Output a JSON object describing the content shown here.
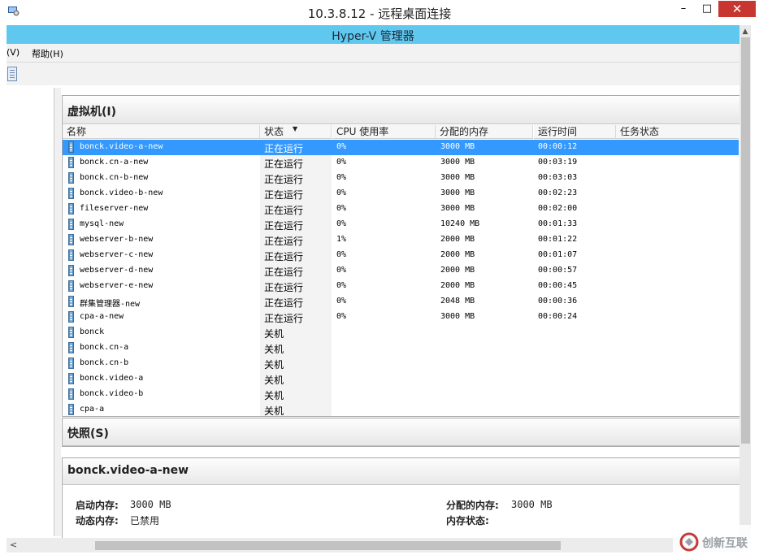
{
  "window": {
    "title": "10.3.8.12 - 远程桌面连接",
    "minimize_glyph": "–",
    "maximize_glyph": "□",
    "close_glyph": "✕"
  },
  "app": {
    "title": "Hyper-V 管理器"
  },
  "menu": {
    "view": "(V)",
    "help": "帮助(H)"
  },
  "vm_section": {
    "title": "虚拟机(I)",
    "columns": [
      "名称",
      "状态",
      "CPU 使用率",
      "分配的内存",
      "运行时间",
      "任务状态"
    ],
    "sort_indicator": "▼",
    "rows": [
      {
        "name": "bonck.video-a-new",
        "state": "正在运行",
        "cpu": "0%",
        "memory": "3000 MB",
        "uptime": "00:00:12",
        "selected": true
      },
      {
        "name": "bonck.cn-a-new",
        "state": "正在运行",
        "cpu": "0%",
        "memory": "3000 MB",
        "uptime": "00:03:19"
      },
      {
        "name": "bonck.cn-b-new",
        "state": "正在运行",
        "cpu": "0%",
        "memory": "3000 MB",
        "uptime": "00:03:03"
      },
      {
        "name": "bonck.video-b-new",
        "state": "正在运行",
        "cpu": "0%",
        "memory": "3000 MB",
        "uptime": "00:02:23"
      },
      {
        "name": "fileserver-new",
        "state": "正在运行",
        "cpu": "0%",
        "memory": "3000 MB",
        "uptime": "00:02:00"
      },
      {
        "name": "mysql-new",
        "state": "正在运行",
        "cpu": "0%",
        "memory": "10240 MB",
        "uptime": "00:01:33"
      },
      {
        "name": "webserver-b-new",
        "state": "正在运行",
        "cpu": "1%",
        "memory": "2000 MB",
        "uptime": "00:01:22"
      },
      {
        "name": "webserver-c-new",
        "state": "正在运行",
        "cpu": "0%",
        "memory": "2000 MB",
        "uptime": "00:01:07"
      },
      {
        "name": "webserver-d-new",
        "state": "正在运行",
        "cpu": "0%",
        "memory": "2000 MB",
        "uptime": "00:00:57"
      },
      {
        "name": "webserver-e-new",
        "state": "正在运行",
        "cpu": "0%",
        "memory": "2000 MB",
        "uptime": "00:00:45"
      },
      {
        "name": "群集管理器-new",
        "state": "正在运行",
        "cpu": "0%",
        "memory": "2048 MB",
        "uptime": "00:00:36"
      },
      {
        "name": "cpa-a-new",
        "state": "正在运行",
        "cpu": "0%",
        "memory": "3000 MB",
        "uptime": "00:00:24"
      },
      {
        "name": "bonck",
        "state": "关机",
        "cpu": "",
        "memory": "",
        "uptime": ""
      },
      {
        "name": "bonck.cn-a",
        "state": "关机",
        "cpu": "",
        "memory": "",
        "uptime": ""
      },
      {
        "name": "bonck.cn-b",
        "state": "关机",
        "cpu": "",
        "memory": "",
        "uptime": ""
      },
      {
        "name": "bonck.video-a",
        "state": "关机",
        "cpu": "",
        "memory": "",
        "uptime": ""
      },
      {
        "name": "bonck.video-b",
        "state": "关机",
        "cpu": "",
        "memory": "",
        "uptime": ""
      },
      {
        "name": "cpa-a",
        "state": "关机",
        "cpu": "",
        "memory": "",
        "uptime": ""
      }
    ]
  },
  "snapshot_section": {
    "title": "快照(S)"
  },
  "details": {
    "title": "bonck.video-a-new",
    "startup_memory_label": "启动内存:",
    "startup_memory_value": "3000 MB",
    "dynamic_memory_label": "动态内存:",
    "dynamic_memory_value": "已禁用",
    "assigned_memory_label": "分配的内存:",
    "assigned_memory_value": "3000 MB",
    "memory_status_label": "内存状态:"
  },
  "scrollbar": {
    "up_glyph": "▲",
    "left_glyph": "<"
  },
  "watermark": {
    "text": "创新互联"
  },
  "colors": {
    "accent_titlebar": "#60c8ee",
    "selection": "#3399ff",
    "close": "#c7372f"
  }
}
